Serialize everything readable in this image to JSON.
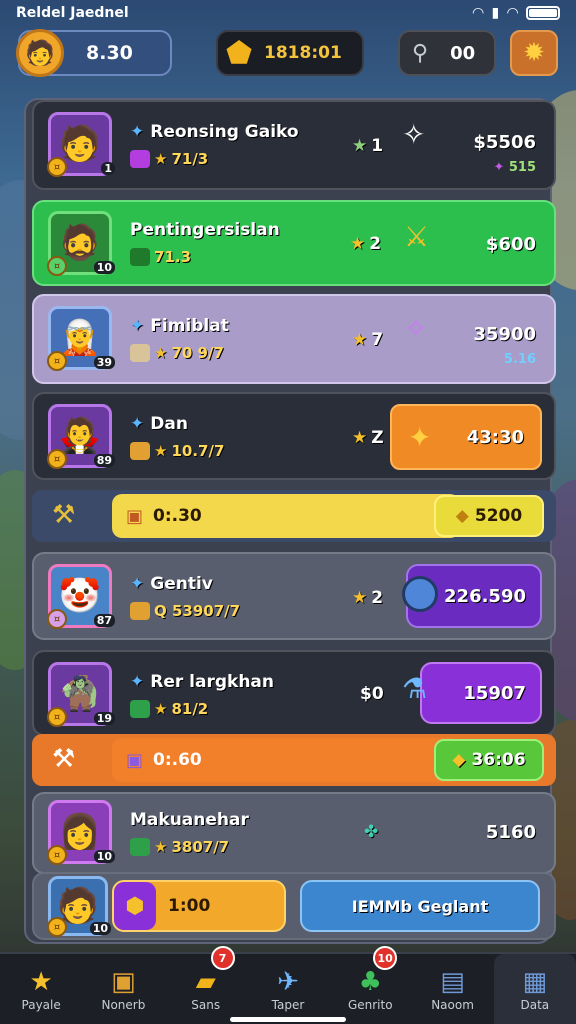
{
  "status_bar": {
    "carrier": "Reldel Jaednel"
  },
  "topbar": {
    "profile_value": "8.30",
    "gold_value": "1818:01",
    "keys_value": "00"
  },
  "rows": [
    {
      "name": "Reonsing Gaiko",
      "sub": "71/3",
      "rank": "1",
      "price": "$5506",
      "price_sub": "515"
    },
    {
      "name": "Pentingersislan",
      "sub": "71.3",
      "rank": "2",
      "price": "$600"
    },
    {
      "name": "Fimiblat",
      "sub": "70 9/7",
      "lvl": "39",
      "rank": "7",
      "price": "35900",
      "price_sub": "5.16"
    },
    {
      "name": "Dan",
      "sub": "10.7/7",
      "lvl": "89",
      "rank": "Z",
      "price": "43:30"
    },
    {
      "name": "Gentiv",
      "sub": "Q 53907/7",
      "lvl": "87",
      "rank": "2",
      "price": "226.590"
    },
    {
      "name": "Rer largkhan",
      "sub": "81/2",
      "lvl": "19",
      "rank": "$0",
      "price": "15907"
    },
    {
      "name": "Makuanehar",
      "sub": "3807/7",
      "lvl": "10",
      "price": "5160"
    }
  ],
  "bars": [
    {
      "value": "0:.30",
      "button": "5200"
    },
    {
      "value": "0:.60",
      "button": "36:06"
    }
  ],
  "bottom_row": {
    "level": "10",
    "progress_value": "1:00",
    "action_button": "IEMMb Geglant"
  },
  "nav": [
    {
      "label": "Payale",
      "icon": "star-icon"
    },
    {
      "label": "Nonerb",
      "icon": "chest-icon"
    },
    {
      "label": "Sans",
      "icon": "gold-bar-icon",
      "badge": "7"
    },
    {
      "label": "Taper",
      "icon": "map-icon"
    },
    {
      "label": "Genrito",
      "icon": "gift-icon",
      "badge": "10"
    },
    {
      "label": "Naoom",
      "icon": "screen-icon"
    },
    {
      "label": "Data",
      "icon": "data-icon"
    }
  ]
}
